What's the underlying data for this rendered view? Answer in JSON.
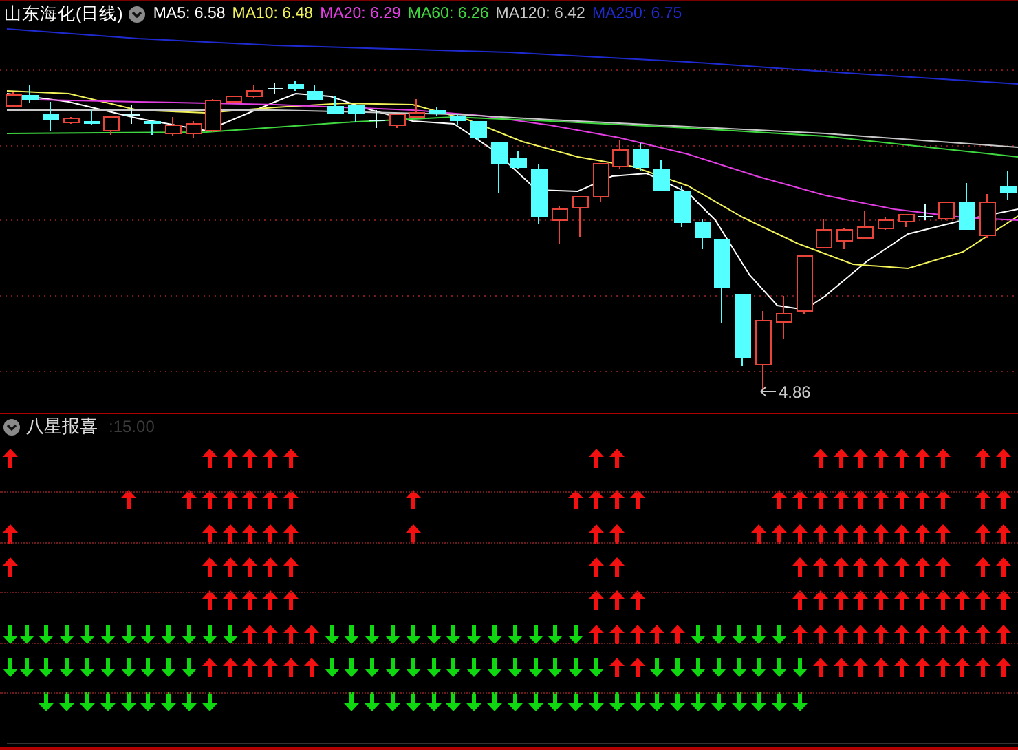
{
  "chart": {
    "title": "山东海化(日线)",
    "indicators": [
      {
        "label": "MA5: 6.58",
        "color": "#ffffff"
      },
      {
        "label": "MA10: 6.48",
        "color": "#f2f25a"
      },
      {
        "label": "MA20: 6.29",
        "color": "#e23ee2"
      },
      {
        "label": "MA60: 6.26",
        "color": "#3fd93f"
      },
      {
        "label": "MA120: 6.42",
        "color": "#c8c8c8"
      },
      {
        "label": "MA250: 6.75",
        "color": "#1f2bd0"
      }
    ],
    "low_label": "4.86"
  },
  "indicator_panel": {
    "title": "八星报喜",
    "value": ":15.00",
    "signal_rows": [
      {
        "cells": [
          {
            "kind": "up"
          },
          null,
          null,
          null,
          null,
          null,
          null,
          null,
          null,
          null,
          {
            "kind": "up"
          },
          {
            "kind": "up"
          },
          {
            "kind": "up"
          },
          {
            "kind": "up"
          },
          {
            "kind": "up"
          },
          null,
          null,
          null,
          null,
          null,
          null,
          null,
          null,
          null,
          null,
          null,
          null,
          null,
          null,
          {
            "kind": "up"
          },
          {
            "kind": "up"
          },
          null,
          null,
          null,
          null,
          null,
          null,
          null,
          null,
          null,
          {
            "kind": "up"
          },
          {
            "kind": "up"
          },
          {
            "kind": "up"
          },
          {
            "kind": "up"
          },
          {
            "kind": "up"
          },
          {
            "kind": "up"
          },
          {
            "kind": "up"
          },
          null,
          {
            "kind": "up"
          },
          {
            "kind": "up"
          }
        ]
      },
      {
        "cells": [
          null,
          null,
          null,
          null,
          null,
          null,
          {
            "kind": "up"
          },
          null,
          null,
          {
            "kind": "up"
          },
          {
            "kind": "up"
          },
          {
            "kind": "up"
          },
          {
            "kind": "up"
          },
          {
            "kind": "up"
          },
          {
            "kind": "up"
          },
          null,
          null,
          null,
          null,
          null,
          {
            "kind": "up"
          },
          null,
          null,
          null,
          null,
          null,
          null,
          null,
          {
            "kind": "up"
          },
          {
            "kind": "up"
          },
          {
            "kind": "up"
          },
          {
            "kind": "up"
          },
          null,
          null,
          null,
          null,
          null,
          null,
          {
            "kind": "up"
          },
          {
            "kind": "up"
          },
          {
            "kind": "up"
          },
          {
            "kind": "up"
          },
          {
            "kind": "up"
          },
          {
            "kind": "up"
          },
          {
            "kind": "up"
          },
          {
            "kind": "up"
          },
          {
            "kind": "up"
          },
          null,
          {
            "kind": "up"
          },
          {
            "kind": "up"
          }
        ]
      },
      {
        "cells": [
          {
            "kind": "up"
          },
          null,
          null,
          null,
          null,
          null,
          null,
          null,
          null,
          null,
          {
            "kind": "up"
          },
          {
            "kind": "up"
          },
          {
            "kind": "up"
          },
          {
            "kind": "up"
          },
          {
            "kind": "up"
          },
          null,
          null,
          null,
          null,
          null,
          {
            "kind": "up"
          },
          null,
          null,
          null,
          null,
          null,
          null,
          null,
          null,
          {
            "kind": "up"
          },
          {
            "kind": "up"
          },
          null,
          null,
          null,
          null,
          null,
          null,
          {
            "kind": "up"
          },
          {
            "kind": "up"
          },
          {
            "kind": "up"
          },
          {
            "kind": "up"
          },
          {
            "kind": "up"
          },
          {
            "kind": "up"
          },
          {
            "kind": "up"
          },
          {
            "kind": "up"
          },
          {
            "kind": "up"
          },
          {
            "kind": "up"
          },
          null,
          {
            "kind": "up"
          },
          {
            "kind": "up"
          }
        ]
      },
      {
        "cells": [
          {
            "kind": "up"
          },
          null,
          null,
          null,
          null,
          null,
          null,
          null,
          null,
          null,
          {
            "kind": "up"
          },
          {
            "kind": "up"
          },
          {
            "kind": "up"
          },
          {
            "kind": "up"
          },
          {
            "kind": "up"
          },
          null,
          null,
          null,
          null,
          null,
          null,
          null,
          null,
          null,
          null,
          null,
          null,
          null,
          null,
          {
            "kind": "up"
          },
          {
            "kind": "up"
          },
          null,
          null,
          null,
          null,
          null,
          null,
          null,
          null,
          {
            "kind": "up"
          },
          {
            "kind": "up"
          },
          {
            "kind": "up"
          },
          {
            "kind": "up"
          },
          {
            "kind": "up"
          },
          {
            "kind": "up"
          },
          {
            "kind": "up"
          },
          {
            "kind": "up"
          },
          null,
          {
            "kind": "up"
          },
          {
            "kind": "up"
          }
        ]
      },
      {
        "cells": [
          null,
          null,
          null,
          null,
          null,
          null,
          null,
          null,
          null,
          null,
          {
            "kind": "up"
          },
          {
            "kind": "up"
          },
          {
            "kind": "up"
          },
          {
            "kind": "up"
          },
          {
            "kind": "up"
          },
          null,
          null,
          null,
          null,
          null,
          null,
          null,
          null,
          null,
          null,
          null,
          null,
          null,
          null,
          {
            "kind": "up"
          },
          {
            "kind": "up"
          },
          {
            "kind": "up"
          },
          null,
          null,
          null,
          null,
          null,
          null,
          null,
          {
            "kind": "up"
          },
          {
            "kind": "up"
          },
          {
            "kind": "up"
          },
          {
            "kind": "up"
          },
          {
            "kind": "up"
          },
          {
            "kind": "up"
          },
          {
            "kind": "up"
          },
          {
            "kind": "up"
          },
          {
            "kind": "up"
          },
          {
            "kind": "up"
          },
          {
            "kind": "up"
          }
        ]
      },
      {
        "cells": [
          {
            "kind": "down"
          },
          {
            "kind": "down"
          },
          {
            "kind": "down"
          },
          {
            "kind": "down"
          },
          {
            "kind": "down"
          },
          {
            "kind": "down"
          },
          {
            "kind": "down"
          },
          {
            "kind": "down"
          },
          {
            "kind": "down"
          },
          {
            "kind": "down"
          },
          {
            "kind": "down"
          },
          {
            "kind": "down"
          },
          {
            "kind": "up"
          },
          {
            "kind": "up"
          },
          {
            "kind": "up"
          },
          {
            "kind": "up"
          },
          {
            "kind": "down"
          },
          {
            "kind": "down"
          },
          {
            "kind": "down"
          },
          {
            "kind": "down"
          },
          {
            "kind": "down"
          },
          {
            "kind": "down"
          },
          {
            "kind": "down"
          },
          {
            "kind": "down"
          },
          {
            "kind": "down"
          },
          {
            "kind": "down"
          },
          {
            "kind": "down"
          },
          {
            "kind": "down"
          },
          {
            "kind": "down"
          },
          {
            "kind": "up"
          },
          {
            "kind": "up"
          },
          {
            "kind": "up"
          },
          {
            "kind": "up"
          },
          {
            "kind": "up"
          },
          {
            "kind": "down"
          },
          {
            "kind": "down"
          },
          {
            "kind": "down"
          },
          {
            "kind": "down"
          },
          {
            "kind": "down"
          },
          {
            "kind": "up"
          },
          {
            "kind": "up"
          },
          {
            "kind": "up"
          },
          {
            "kind": "up"
          },
          {
            "kind": "up"
          },
          {
            "kind": "up"
          },
          {
            "kind": "up"
          },
          {
            "kind": "up"
          },
          {
            "kind": "up"
          },
          {
            "kind": "up"
          },
          {
            "kind": "up"
          }
        ]
      },
      {
        "cells": [
          {
            "kind": "down"
          },
          {
            "kind": "down"
          },
          {
            "kind": "down"
          },
          {
            "kind": "down"
          },
          {
            "kind": "down"
          },
          {
            "kind": "down"
          },
          {
            "kind": "down"
          },
          {
            "kind": "down"
          },
          {
            "kind": "down"
          },
          {
            "kind": "down"
          },
          {
            "kind": "up"
          },
          {
            "kind": "up"
          },
          {
            "kind": "up"
          },
          {
            "kind": "up"
          },
          {
            "kind": "up"
          },
          {
            "kind": "up"
          },
          {
            "kind": "down"
          },
          {
            "kind": "down"
          },
          {
            "kind": "down"
          },
          {
            "kind": "down"
          },
          {
            "kind": "down"
          },
          {
            "kind": "down"
          },
          {
            "kind": "down"
          },
          {
            "kind": "down"
          },
          {
            "kind": "down"
          },
          {
            "kind": "down"
          },
          {
            "kind": "down"
          },
          {
            "kind": "down"
          },
          {
            "kind": "down"
          },
          {
            "kind": "down"
          },
          {
            "kind": "up"
          },
          {
            "kind": "up"
          },
          {
            "kind": "down"
          },
          {
            "kind": "down"
          },
          {
            "kind": "down"
          },
          {
            "kind": "down"
          },
          {
            "kind": "down"
          },
          {
            "kind": "down"
          },
          {
            "kind": "down"
          },
          {
            "kind": "down"
          },
          {
            "kind": "up"
          },
          {
            "kind": "up"
          },
          {
            "kind": "up"
          },
          {
            "kind": "up"
          },
          {
            "kind": "up"
          },
          {
            "kind": "up"
          },
          {
            "kind": "up"
          },
          {
            "kind": "up"
          },
          {
            "kind": "up"
          },
          {
            "kind": "up"
          }
        ]
      },
      {
        "cells": [
          null,
          null,
          {
            "kind": "down"
          },
          {
            "kind": "down"
          },
          {
            "kind": "down"
          },
          {
            "kind": "down"
          },
          {
            "kind": "down"
          },
          {
            "kind": "down"
          },
          {
            "kind": "down"
          },
          {
            "kind": "down"
          },
          {
            "kind": "down"
          },
          null,
          null,
          null,
          null,
          null,
          null,
          {
            "kind": "down"
          },
          {
            "kind": "down"
          },
          {
            "kind": "down"
          },
          {
            "kind": "down"
          },
          {
            "kind": "down"
          },
          {
            "kind": "down"
          },
          {
            "kind": "down"
          },
          {
            "kind": "down"
          },
          {
            "kind": "down"
          },
          {
            "kind": "down"
          },
          {
            "kind": "down"
          },
          {
            "kind": "down"
          },
          {
            "kind": "down"
          },
          {
            "kind": "down"
          },
          {
            "kind": "down"
          },
          {
            "kind": "down"
          },
          {
            "kind": "down"
          },
          {
            "kind": "down"
          },
          {
            "kind": "down"
          },
          {
            "kind": "down"
          },
          {
            "kind": "down"
          },
          {
            "kind": "down"
          },
          {
            "kind": "down"
          },
          null,
          null,
          null,
          null,
          null,
          null,
          null,
          null,
          null,
          null
        ]
      }
    ]
  }
}
